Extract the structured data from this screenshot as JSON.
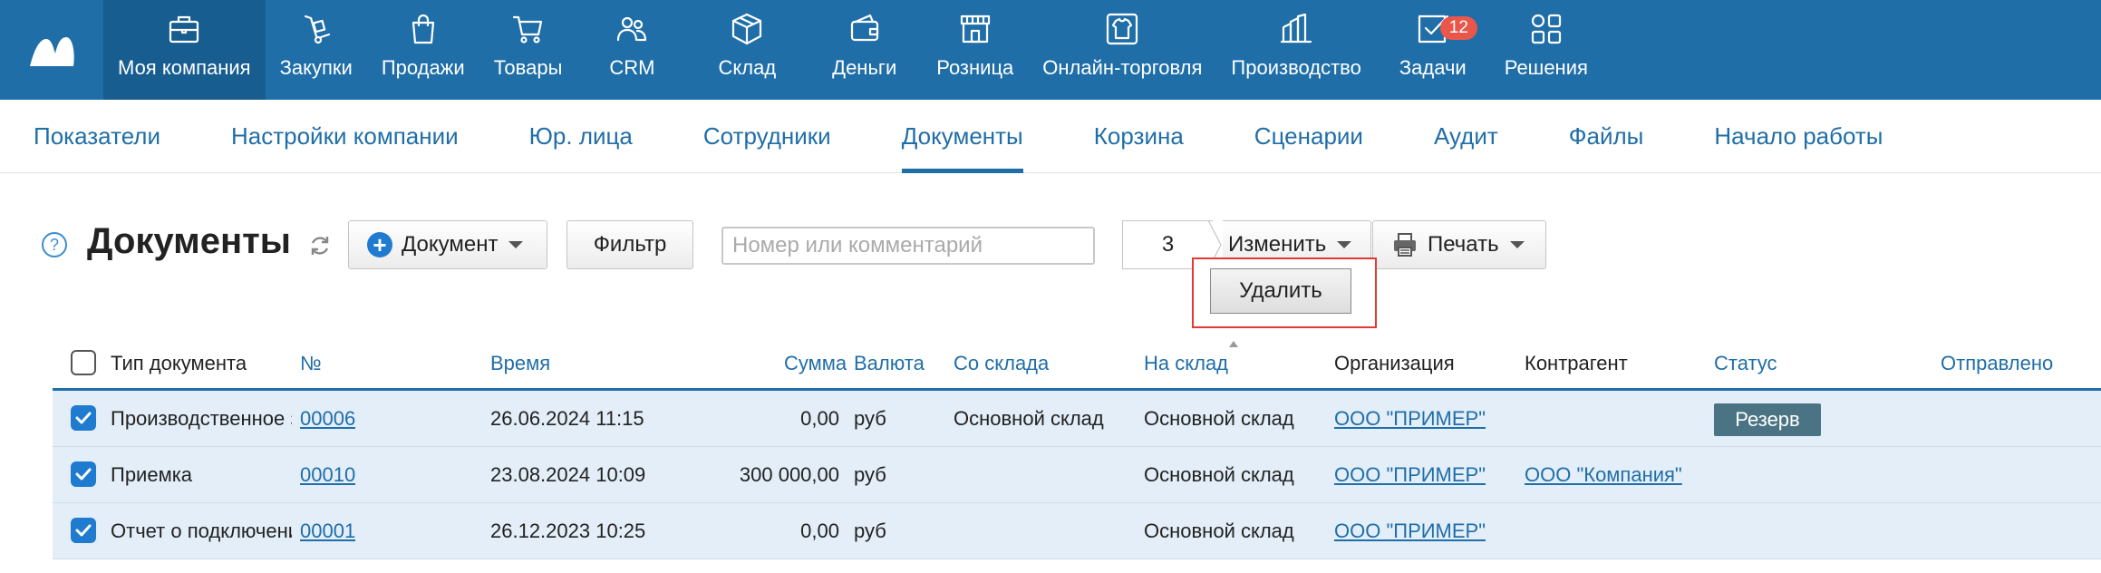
{
  "topnav": {
    "items": [
      {
        "label": "Моя компания",
        "icon": "briefcase-icon"
      },
      {
        "label": "Закупки",
        "icon": "cart-dolly-icon"
      },
      {
        "label": "Продажи",
        "icon": "shopping-bag-icon"
      },
      {
        "label": "Товары",
        "icon": "cart-icon"
      },
      {
        "label": "CRM",
        "icon": "people-icon"
      },
      {
        "label": "Склад",
        "icon": "box-icon"
      },
      {
        "label": "Деньги",
        "icon": "wallet-icon"
      },
      {
        "label": "Розница",
        "icon": "store-icon"
      },
      {
        "label": "Онлайн-торговля",
        "icon": "tshirt-icon"
      },
      {
        "label": "Производство",
        "icon": "factory-icon"
      },
      {
        "label": "Задачи",
        "icon": "checkbox-icon",
        "badge": "12"
      },
      {
        "label": "Решения",
        "icon": "apps-grid-icon"
      }
    ],
    "active_index": 0
  },
  "subnav": {
    "items": [
      "Показатели",
      "Настройки компании",
      "Юр. лица",
      "Сотрудники",
      "Документы",
      "Корзина",
      "Сценарии",
      "Аудит",
      "Файлы",
      "Начало работы"
    ],
    "active_index": 4
  },
  "toolbar": {
    "help": "?",
    "title": "Документы",
    "document_label": "Документ",
    "filter_label": "Фильтр",
    "search_placeholder": "Номер или комментарий",
    "selected_count": "3",
    "change_label": "Изменить",
    "print_label": "Печать",
    "delete_label": "Удалить"
  },
  "table": {
    "headers": {
      "type": "Тип документа",
      "number": "№",
      "time": "Время",
      "sum": "Сумма",
      "currency": "Валюта",
      "from_store": "Со склада",
      "to_store": "На склад",
      "org": "Организация",
      "counterparty": "Контрагент",
      "status": "Статус",
      "sent": "Отправлено"
    },
    "rows": [
      {
        "type": "Производственное задание",
        "number": "00006",
        "time": "26.06.2024 11:15",
        "sum": "0,00",
        "currency": "руб",
        "from_store": "Основной склад",
        "to_store": "Основной склад",
        "org": "ООО \"ПРИМЕР\"",
        "counterparty": "",
        "status": "Резерв"
      },
      {
        "type": "Приемка",
        "number": "00010",
        "time": "23.08.2024 10:09",
        "sum": "300 000,00",
        "currency": "руб",
        "from_store": "",
        "to_store": "Основной склад",
        "org": "ООО \"ПРИМЕР\"",
        "counterparty": "ООО \"Компания\"",
        "status": ""
      },
      {
        "type": "Отчет о подключении",
        "number": "00001",
        "time": "26.12.2023 10:25",
        "sum": "0,00",
        "currency": "руб",
        "from_store": "",
        "to_store": "Основной склад",
        "org": "ООО \"ПРИМЕР\"",
        "counterparty": "",
        "status": ""
      }
    ]
  },
  "colors": {
    "topnav_bg": "#1f6ea8",
    "topnav_active": "#175d90",
    "link": "#1f6ea8",
    "row_selected": "#e3eef8",
    "badge": "#e8574a",
    "status_badge": "#4a7484",
    "highlight_border": "#e53935"
  }
}
